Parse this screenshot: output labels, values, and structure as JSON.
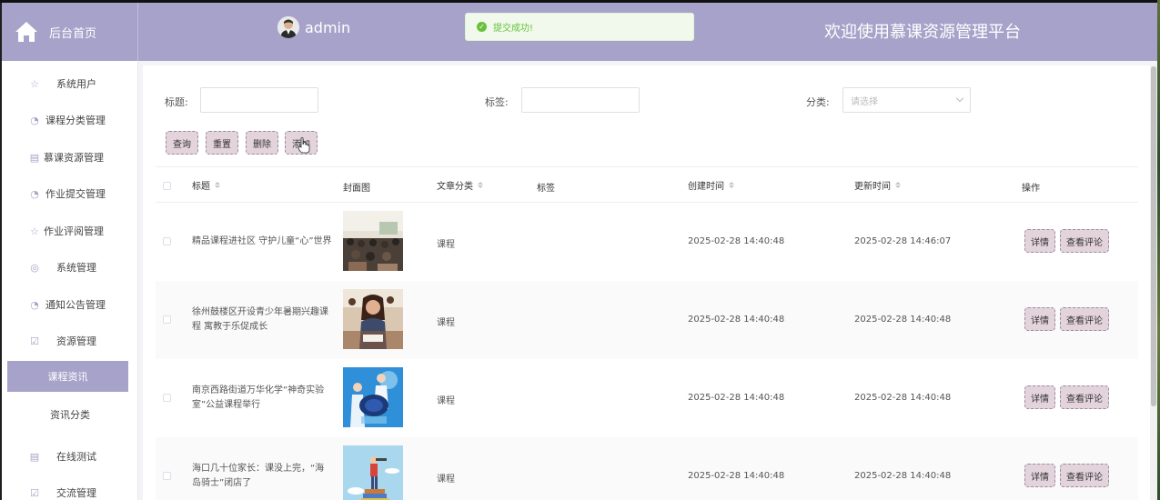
{
  "header": {
    "brand_label": "后台首页",
    "username": "admin",
    "toast": "提交成功!",
    "welcome": "欢迎使用慕课资源管理平台"
  },
  "sidebar": {
    "items": [
      {
        "label": "系统用户",
        "icon": "star-icon"
      },
      {
        "label": "课程分类管理",
        "icon": "pie-icon"
      },
      {
        "label": "慕课资源管理",
        "icon": "bin-icon"
      },
      {
        "label": "作业提交管理",
        "icon": "pie-icon"
      },
      {
        "label": "作业评阅管理",
        "icon": "star-icon"
      },
      {
        "label": "系统管理",
        "icon": "compass-icon"
      },
      {
        "label": "通知公告管理",
        "icon": "pie-icon"
      },
      {
        "label": "资源管理",
        "icon": "check-icon"
      },
      {
        "label": "课程资讯",
        "active": true
      },
      {
        "label": "资讯分类"
      },
      {
        "label": "在线测试",
        "icon": "bin-icon"
      },
      {
        "label": "交流管理",
        "icon": "check-icon"
      }
    ]
  },
  "filters": {
    "title_label": "标题:",
    "tag_label": "标签:",
    "category_label": "分类:",
    "category_placeholder": "请选择"
  },
  "buttons": {
    "query": "查询",
    "reset": "重置",
    "delete": "删除",
    "add": "添加"
  },
  "table": {
    "headers": {
      "title": "标题",
      "cover": "封面图",
      "category": "文章分类",
      "tag": "标签",
      "created": "创建时间",
      "updated": "更新时间",
      "actions": "操作"
    },
    "rows": [
      {
        "title": "精品课程进社区 守护儿童“心”世界",
        "category": "课程",
        "tag": "",
        "created": "2025-02-28 14:40:48",
        "updated": "2025-02-28 14:46:07"
      },
      {
        "title": "徐州鼓楼区开设青少年暑期兴趣课程 寓教于乐促成长",
        "category": "课程",
        "tag": "",
        "created": "2025-02-28 14:40:48",
        "updated": "2025-02-28 14:40:48"
      },
      {
        "title": "南京西路街道万华化学“神奇实验室”公益课程举行",
        "category": "课程",
        "tag": "",
        "created": "2025-02-28 14:40:48",
        "updated": "2025-02-28 14:40:48"
      },
      {
        "title": "海口几十位家长：课没上完，“海岛骑士”闭店了",
        "category": "课程",
        "tag": "",
        "created": "2025-02-28 14:40:48",
        "updated": "2025-02-28 14:40:48"
      }
    ],
    "detail_label": "详情",
    "comments_label": "查看评论"
  },
  "colors": {
    "header": "#a7a2c9",
    "button_bg": "#e3d3db",
    "success": "#67c23a"
  }
}
